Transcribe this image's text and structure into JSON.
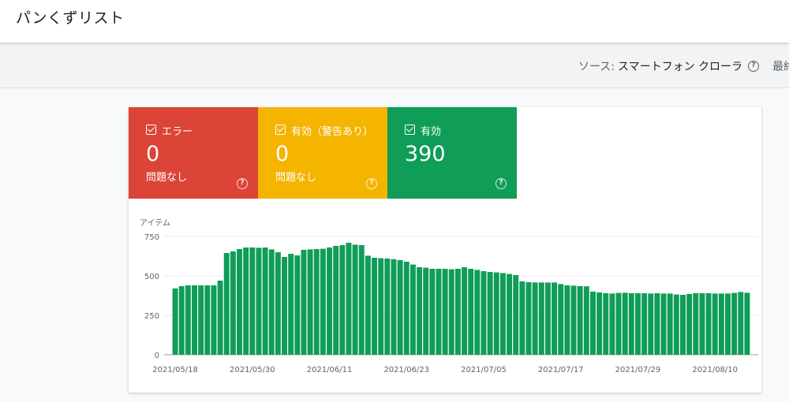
{
  "header": {
    "title": "パンくずリスト"
  },
  "source_bar": {
    "label": "ソース:",
    "value": "スマートフォン クローラ",
    "help_icon": "question-circle-icon",
    "latest_label": "最終"
  },
  "tiles": [
    {
      "label": "エラー",
      "count": "0",
      "sub": "問題なし",
      "color": "#db4437",
      "icon": "checkbox-checked-icon"
    },
    {
      "label": "有効（警告あり）",
      "count": "0",
      "sub": "問題なし",
      "color": "#f4b400",
      "icon": "checkbox-checked-icon"
    },
    {
      "label": "有効",
      "count": "390",
      "sub": "",
      "color": "#0f9d58",
      "icon": "checkbox-checked-icon"
    }
  ],
  "chart_data": {
    "type": "bar",
    "ylabel": "アイテム",
    "ylim": [
      0,
      750
    ],
    "y_ticks": [
      "0",
      "250",
      "500",
      "750"
    ],
    "x_tick_labels": [
      "2021/05/18",
      "2021/05/30",
      "2021/06/11",
      "2021/06/23",
      "2021/07/05",
      "2021/07/17",
      "2021/07/29",
      "2021/08/10"
    ],
    "bar_color": "#0f9d58",
    "grid": true,
    "series": [
      {
        "values": [
          420,
          435,
          440,
          440,
          440,
          440,
          440,
          470,
          645,
          655,
          670,
          680,
          680,
          678,
          680,
          668,
          650,
          620,
          640,
          630,
          665,
          668,
          670,
          672,
          680,
          690,
          695,
          710,
          698,
          695,
          628,
          615,
          612,
          610,
          606,
          600,
          590,
          572,
          555,
          552,
          545,
          545,
          545,
          542,
          545,
          555,
          545,
          538,
          530,
          525,
          522,
          518,
          512,
          505,
          465,
          460,
          458,
          458,
          458,
          458,
          448,
          440,
          438,
          435,
          434,
          400,
          395,
          390,
          388,
          392,
          393,
          390,
          390,
          390,
          388,
          390,
          388,
          388,
          382,
          380,
          385,
          390,
          390,
          390,
          388,
          388,
          388,
          392,
          398,
          393
        ]
      }
    ]
  }
}
